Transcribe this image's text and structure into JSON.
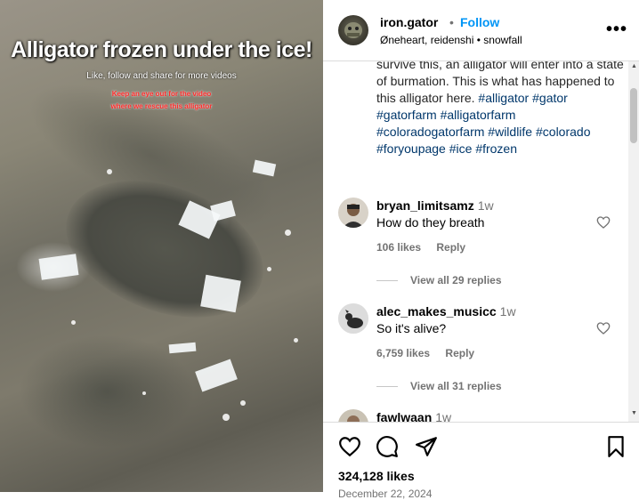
{
  "media": {
    "title": "Alligator frozen under the ice!",
    "subtitle": "Like, follow and share for more videos",
    "red_line1": "Keep an eye out for the video",
    "red_line2": "where we rescue this alligator"
  },
  "header": {
    "username": "iron.gator",
    "separator": "•",
    "follow_label": "Follow",
    "audio": "Øneheart, reidenshi • snowfall",
    "more_label": "•••"
  },
  "caption": {
    "text": "survive this, an alligator will enter into a state of burmation. This is what has happened to this alligator here.",
    "hashtags": [
      "#alligator",
      "#gator",
      "#gatorfarm",
      "#alligatorfarm",
      "#coloradogatorfarm",
      "#wildlife",
      "#colorado",
      "#foryoupage",
      "#ice",
      "#frozen"
    ]
  },
  "comments": [
    {
      "username": "bryan_limitsamz",
      "time": "1w",
      "text": "How do they breath",
      "likes": "106 likes",
      "reply": "Reply",
      "view_replies": "View all 29 replies"
    },
    {
      "username": "alec_makes_musicc",
      "time": "1w",
      "text": "So it's alive?",
      "likes": "6,759 likes",
      "reply": "Reply",
      "view_replies": "View all 31 replies"
    },
    {
      "username": "fawlwaan",
      "time": "1w"
    }
  ],
  "actions": {
    "likes_count": "324,128 likes",
    "date": "December 22, 2024"
  },
  "colors": {
    "follow": "#0095f6",
    "hashtag": "#00376b",
    "meta": "#737373"
  }
}
